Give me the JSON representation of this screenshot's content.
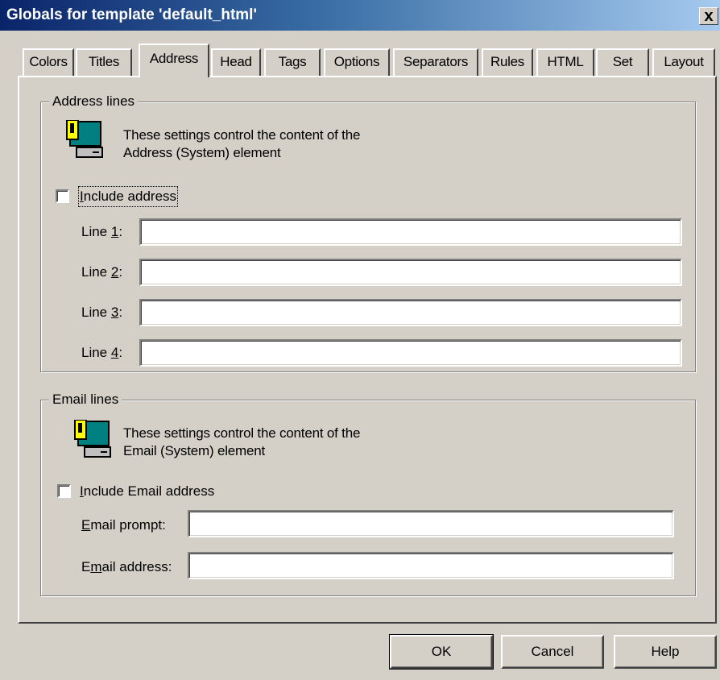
{
  "window": {
    "title": "Globals for template 'default_html'",
    "close_glyph": "x"
  },
  "tabs": [
    {
      "label": "Colors",
      "active": false
    },
    {
      "label": "Titles",
      "active": false
    },
    {
      "label": "Address",
      "active": true
    },
    {
      "label": "Head",
      "active": false
    },
    {
      "label": "Tags",
      "active": false
    },
    {
      "label": "Options",
      "active": false
    },
    {
      "label": "Separators",
      "active": false
    },
    {
      "label": "Rules",
      "active": false
    },
    {
      "label": "HTML",
      "active": false
    },
    {
      "label": "Set",
      "active": false
    },
    {
      "label": "Layout",
      "active": false
    }
  ],
  "address_group": {
    "title": "Address lines",
    "icon": "computer-icon",
    "desc_line1": "These settings control the content of the",
    "desc_line2": "Address (System) element",
    "checkbox_label": "Include address",
    "checkbox_checked": false,
    "lines": [
      {
        "label_prefix": "Line ",
        "label_key": "1",
        "label_suffix": ":",
        "value": ""
      },
      {
        "label_prefix": "Line ",
        "label_key": "2",
        "label_suffix": ":",
        "value": ""
      },
      {
        "label_prefix": "Line ",
        "label_key": "3",
        "label_suffix": ":",
        "value": ""
      },
      {
        "label_prefix": "Line ",
        "label_key": "4",
        "label_suffix": ":",
        "value": ""
      }
    ]
  },
  "email_group": {
    "title": "Email lines",
    "icon": "computer-icon",
    "desc_line1": "These settings control the content of the",
    "desc_line2": "Email (System) element",
    "checkbox_key": "I",
    "checkbox_rest": "nclude Email address",
    "checkbox_checked": false,
    "prompt_key": "E",
    "prompt_rest": "mail prompt:",
    "prompt_value": "",
    "address_pre": "E",
    "address_key": "m",
    "address_rest": "ail address:",
    "address_value": ""
  },
  "buttons": {
    "ok": "OK",
    "cancel": "Cancel",
    "help": "Help"
  },
  "colors": {
    "title_start": "#0a246a",
    "title_end": "#a6caf0",
    "face": "#d4d0c8",
    "icon_yellow": "#ffff00",
    "icon_teal": "#008080"
  }
}
